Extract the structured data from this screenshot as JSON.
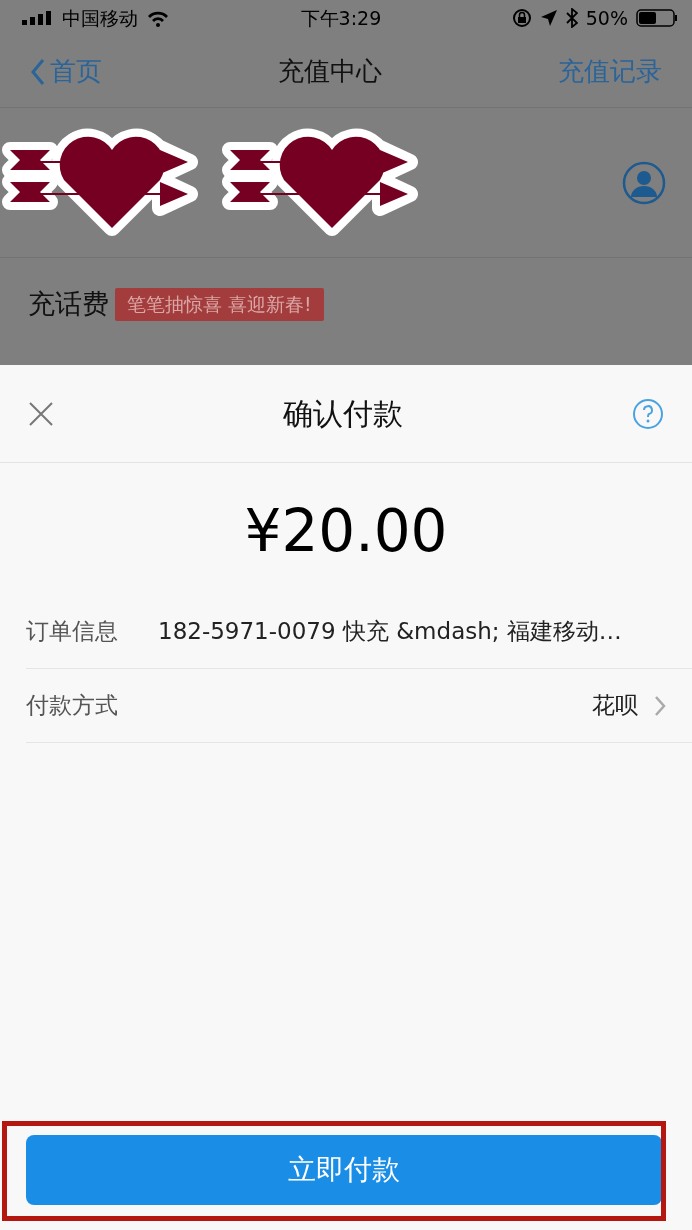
{
  "status_bar": {
    "carrier": "中国移动",
    "time": "下午3:29",
    "battery": "50%"
  },
  "nav": {
    "back": "首页",
    "title": "充值中心",
    "action": "充值记录"
  },
  "section": {
    "title": "充话费",
    "promo": "笔笔抽惊喜 喜迎新春!"
  },
  "sheet": {
    "title": "确认付款",
    "amount": "¥20.00",
    "rows": [
      {
        "label": "订单信息",
        "value": "182-5971-0079 快充 &mdash; 福建移动…",
        "kind": "info"
      },
      {
        "label": "付款方式",
        "value": "花呗",
        "kind": "link"
      }
    ],
    "button": "立即付款"
  }
}
